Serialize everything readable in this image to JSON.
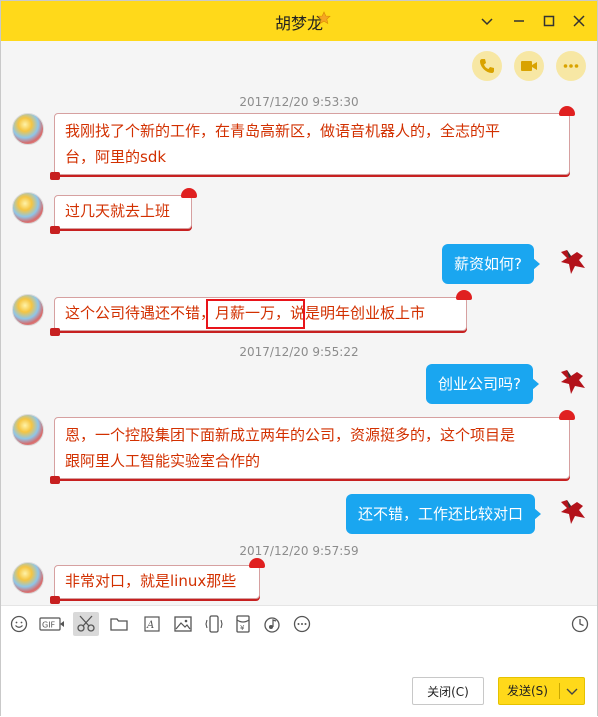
{
  "window": {
    "title": "胡梦龙",
    "minimize_icon": "minimize-icon",
    "maximize_icon": "maximize-icon",
    "close_icon": "close-icon",
    "dropdown_icon": "chevron-down-icon"
  },
  "chat_tools": [
    "phone-icon",
    "video-icon",
    "more-icon"
  ],
  "messages": {
    "ts1": "2017/12/20 9:53:30",
    "m1_line1": "我刚找了个新的工作，在青岛高新区，做语音机器人的，全志的平",
    "m1_line2": "台，阿里的sdk",
    "m2": "过几天就去上班",
    "m3": "薪资如何?",
    "m4": "这个公司待遇还不错，月薪一万，说是明年创业板上市",
    "ts2": "2017/12/20 9:55:22",
    "m5": "创业公司吗?",
    "m6_line1": "恩，一个控股集团下面新成立两年的公司，资源挺多的，这个项目是",
    "m6_line2": "跟阿里人工智能实验室合作的",
    "m7": "还不错，工作还比较对口",
    "ts3": "2017/12/20 9:57:59",
    "m8": "非常对口，就是linux那些"
  },
  "toolbar_icons": [
    "emoji-icon",
    "gif-icon",
    "screenshot-scissors-icon",
    "folder-icon",
    "font-icon",
    "image-icon",
    "shake-icon",
    "red-packet-icon",
    "music-icon",
    "more-icon",
    "history-clock-icon"
  ],
  "buttons": {
    "close_label": "关闭(C)",
    "send_label": "发送(S)"
  },
  "colors": {
    "titlebar": "#ffd91a",
    "self_bubble": "#1aa6f0",
    "peer_text": "#d23000",
    "highlight": "#e8141a"
  }
}
